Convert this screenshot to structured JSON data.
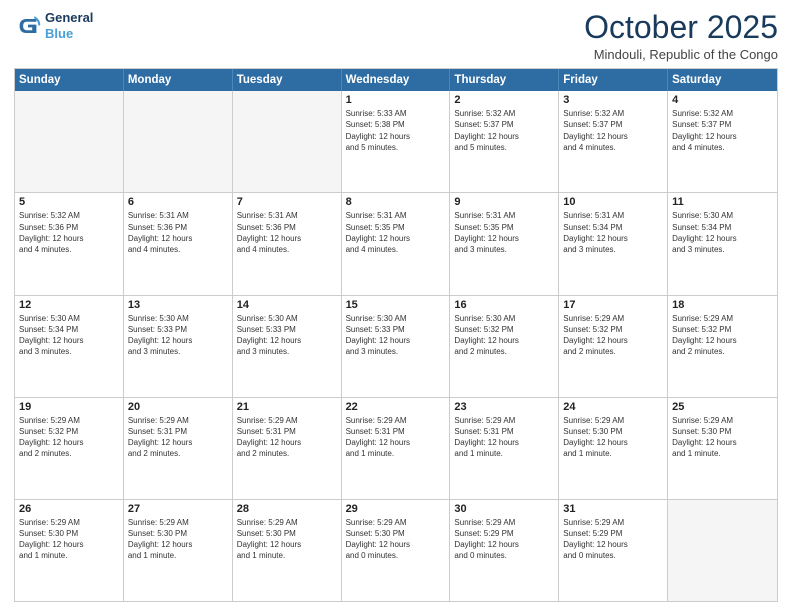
{
  "header": {
    "logo_line1": "General",
    "logo_line2": "Blue",
    "month_title": "October 2025",
    "location": "Mindouli, Republic of the Congo"
  },
  "weekdays": [
    "Sunday",
    "Monday",
    "Tuesday",
    "Wednesday",
    "Thursday",
    "Friday",
    "Saturday"
  ],
  "weeks": [
    [
      {
        "day": "",
        "info": ""
      },
      {
        "day": "",
        "info": ""
      },
      {
        "day": "",
        "info": ""
      },
      {
        "day": "1",
        "info": "Sunrise: 5:33 AM\nSunset: 5:38 PM\nDaylight: 12 hours\nand 5 minutes."
      },
      {
        "day": "2",
        "info": "Sunrise: 5:32 AM\nSunset: 5:37 PM\nDaylight: 12 hours\nand 5 minutes."
      },
      {
        "day": "3",
        "info": "Sunrise: 5:32 AM\nSunset: 5:37 PM\nDaylight: 12 hours\nand 4 minutes."
      },
      {
        "day": "4",
        "info": "Sunrise: 5:32 AM\nSunset: 5:37 PM\nDaylight: 12 hours\nand 4 minutes."
      }
    ],
    [
      {
        "day": "5",
        "info": "Sunrise: 5:32 AM\nSunset: 5:36 PM\nDaylight: 12 hours\nand 4 minutes."
      },
      {
        "day": "6",
        "info": "Sunrise: 5:31 AM\nSunset: 5:36 PM\nDaylight: 12 hours\nand 4 minutes."
      },
      {
        "day": "7",
        "info": "Sunrise: 5:31 AM\nSunset: 5:36 PM\nDaylight: 12 hours\nand 4 minutes."
      },
      {
        "day": "8",
        "info": "Sunrise: 5:31 AM\nSunset: 5:35 PM\nDaylight: 12 hours\nand 4 minutes."
      },
      {
        "day": "9",
        "info": "Sunrise: 5:31 AM\nSunset: 5:35 PM\nDaylight: 12 hours\nand 3 minutes."
      },
      {
        "day": "10",
        "info": "Sunrise: 5:31 AM\nSunset: 5:34 PM\nDaylight: 12 hours\nand 3 minutes."
      },
      {
        "day": "11",
        "info": "Sunrise: 5:30 AM\nSunset: 5:34 PM\nDaylight: 12 hours\nand 3 minutes."
      }
    ],
    [
      {
        "day": "12",
        "info": "Sunrise: 5:30 AM\nSunset: 5:34 PM\nDaylight: 12 hours\nand 3 minutes."
      },
      {
        "day": "13",
        "info": "Sunrise: 5:30 AM\nSunset: 5:33 PM\nDaylight: 12 hours\nand 3 minutes."
      },
      {
        "day": "14",
        "info": "Sunrise: 5:30 AM\nSunset: 5:33 PM\nDaylight: 12 hours\nand 3 minutes."
      },
      {
        "day": "15",
        "info": "Sunrise: 5:30 AM\nSunset: 5:33 PM\nDaylight: 12 hours\nand 3 minutes."
      },
      {
        "day": "16",
        "info": "Sunrise: 5:30 AM\nSunset: 5:32 PM\nDaylight: 12 hours\nand 2 minutes."
      },
      {
        "day": "17",
        "info": "Sunrise: 5:29 AM\nSunset: 5:32 PM\nDaylight: 12 hours\nand 2 minutes."
      },
      {
        "day": "18",
        "info": "Sunrise: 5:29 AM\nSunset: 5:32 PM\nDaylight: 12 hours\nand 2 minutes."
      }
    ],
    [
      {
        "day": "19",
        "info": "Sunrise: 5:29 AM\nSunset: 5:32 PM\nDaylight: 12 hours\nand 2 minutes."
      },
      {
        "day": "20",
        "info": "Sunrise: 5:29 AM\nSunset: 5:31 PM\nDaylight: 12 hours\nand 2 minutes."
      },
      {
        "day": "21",
        "info": "Sunrise: 5:29 AM\nSunset: 5:31 PM\nDaylight: 12 hours\nand 2 minutes."
      },
      {
        "day": "22",
        "info": "Sunrise: 5:29 AM\nSunset: 5:31 PM\nDaylight: 12 hours\nand 1 minute."
      },
      {
        "day": "23",
        "info": "Sunrise: 5:29 AM\nSunset: 5:31 PM\nDaylight: 12 hours\nand 1 minute."
      },
      {
        "day": "24",
        "info": "Sunrise: 5:29 AM\nSunset: 5:30 PM\nDaylight: 12 hours\nand 1 minute."
      },
      {
        "day": "25",
        "info": "Sunrise: 5:29 AM\nSunset: 5:30 PM\nDaylight: 12 hours\nand 1 minute."
      }
    ],
    [
      {
        "day": "26",
        "info": "Sunrise: 5:29 AM\nSunset: 5:30 PM\nDaylight: 12 hours\nand 1 minute."
      },
      {
        "day": "27",
        "info": "Sunrise: 5:29 AM\nSunset: 5:30 PM\nDaylight: 12 hours\nand 1 minute."
      },
      {
        "day": "28",
        "info": "Sunrise: 5:29 AM\nSunset: 5:30 PM\nDaylight: 12 hours\nand 1 minute."
      },
      {
        "day": "29",
        "info": "Sunrise: 5:29 AM\nSunset: 5:30 PM\nDaylight: 12 hours\nand 0 minutes."
      },
      {
        "day": "30",
        "info": "Sunrise: 5:29 AM\nSunset: 5:29 PM\nDaylight: 12 hours\nand 0 minutes."
      },
      {
        "day": "31",
        "info": "Sunrise: 5:29 AM\nSunset: 5:29 PM\nDaylight: 12 hours\nand 0 minutes."
      },
      {
        "day": "",
        "info": ""
      }
    ]
  ]
}
